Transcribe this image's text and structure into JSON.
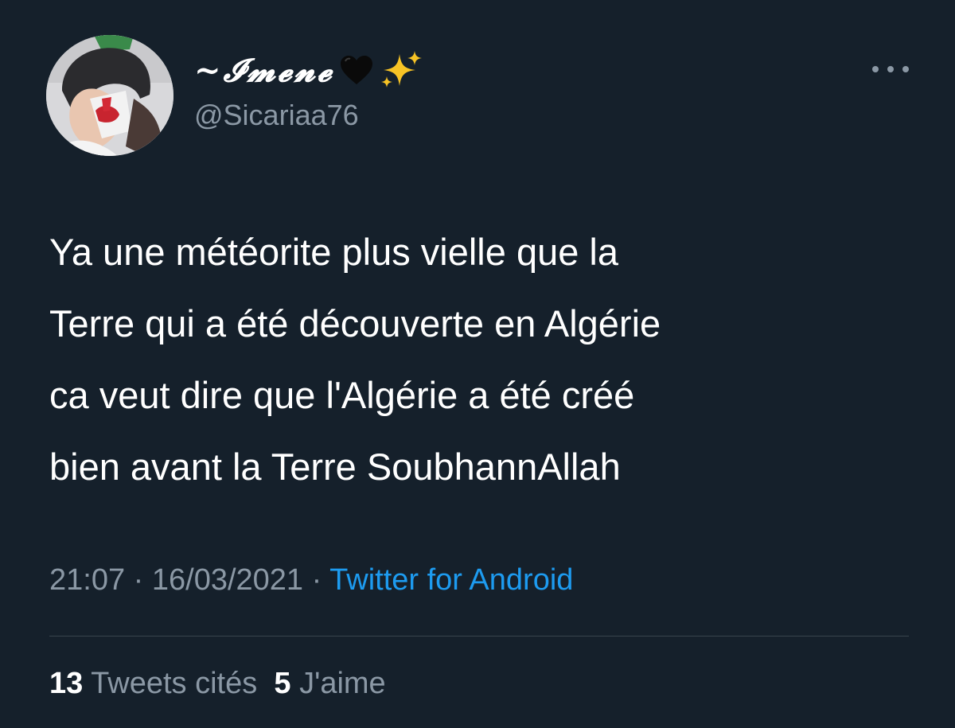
{
  "author": {
    "display_name": "~𝓘𝓶𝓮𝓷𝓮",
    "handle": "@Sicariaa76"
  },
  "tweet": {
    "text_lines": [
      "Ya une météorite plus vielle que la",
      "Terre qui a été découverte en Algérie",
      "ca veut dire que l'Algérie a été créé",
      "bien avant la Terre SoubhannAllah"
    ],
    "time": "21:07",
    "separator": " · ",
    "date": "16/03/2021",
    "source": "Twitter for Android"
  },
  "stats": {
    "quotes_count": "13",
    "quotes_label": "Tweets cités",
    "likes_count": "5",
    "likes_label": "J'aime"
  },
  "icons": {
    "heart": "black-heart-icon",
    "sparkles": "sparkles-icon",
    "more": "more-options-icon"
  },
  "colors": {
    "background": "#15202b",
    "link": "#1d9bf0",
    "secondary_text": "#8b98a5",
    "divider": "#38444d"
  }
}
